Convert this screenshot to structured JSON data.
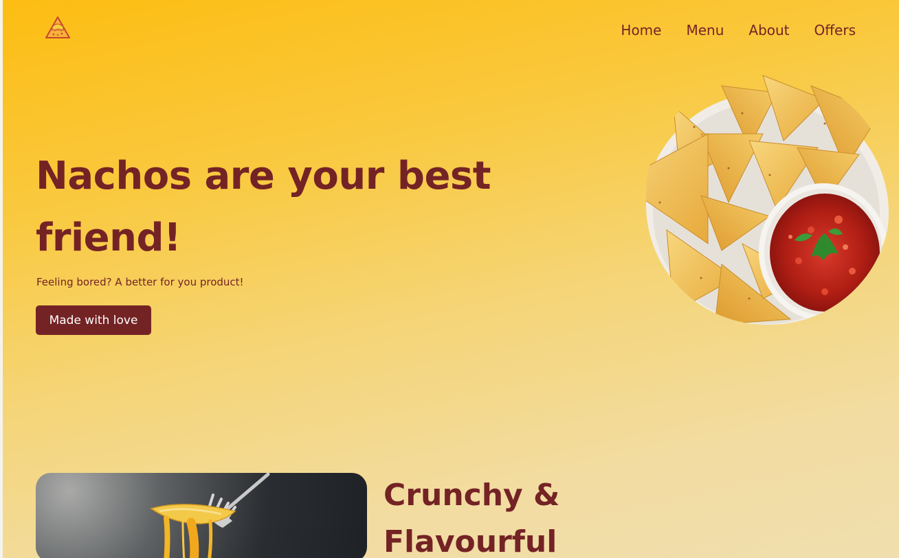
{
  "nav": {
    "items": [
      {
        "label": "Home"
      },
      {
        "label": "Menu"
      },
      {
        "label": "About"
      },
      {
        "label": "Offers"
      }
    ]
  },
  "hero": {
    "title": "Nachos are your best friend!",
    "subtitle": "Feeling bored? A better for you product!",
    "cta_label": "Made with love"
  },
  "feature": {
    "title": "Crunchy & Flavourful"
  },
  "colors": {
    "primary": "#742325",
    "background_start": "#fdbd12",
    "background_end": "#f0deae"
  },
  "icons": {
    "logo": "nacho-logo-icon"
  }
}
